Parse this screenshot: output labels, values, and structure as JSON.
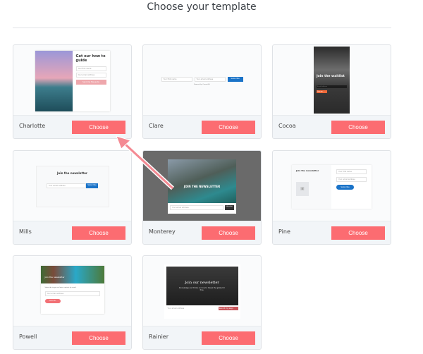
{
  "page": {
    "title": "Choose your template"
  },
  "choose_label": "Choose",
  "templates": [
    {
      "name": "Charlotte",
      "heading": "Get our how to guide",
      "field1": "Your first name",
      "field2": "Your email address",
      "button": "Send me the guide"
    },
    {
      "name": "Clare",
      "field1": "Your first name",
      "field2": "Your email address",
      "button": "Subscribe",
      "powered": "Powered by ConvertKit"
    },
    {
      "name": "Cocoa",
      "heading": "Join the waitlist",
      "field1": "Email address",
      "button": "Sign up"
    },
    {
      "name": "Mills",
      "heading": "Join the newsletter",
      "field1": "Your email address",
      "button": "Subscribe"
    },
    {
      "name": "Monterey",
      "heading": "JOIN THE NEWSLETTER",
      "field1": "Your email address",
      "button": "Subscribe"
    },
    {
      "name": "Pine",
      "heading": "Join the newsletter",
      "field1": "Your first name",
      "field2": "Your email address",
      "button": "Subscribe"
    },
    {
      "name": "Powell",
      "heading": "Join the newsletter",
      "sub": "Subscribe to get our latest content by email.",
      "field1": "Your email address",
      "button": "Subscribe"
    },
    {
      "name": "Rainier",
      "heading": "Join our newsletter",
      "sub": "Knowledge and tricks on how to travel the globe for free.",
      "field1": "Your email address",
      "button": "Send it my way!"
    }
  ],
  "colors": {
    "choose_button": "#fc6c71",
    "arrow": "#f48a93",
    "subscribe_blue": "#1a73c8"
  }
}
